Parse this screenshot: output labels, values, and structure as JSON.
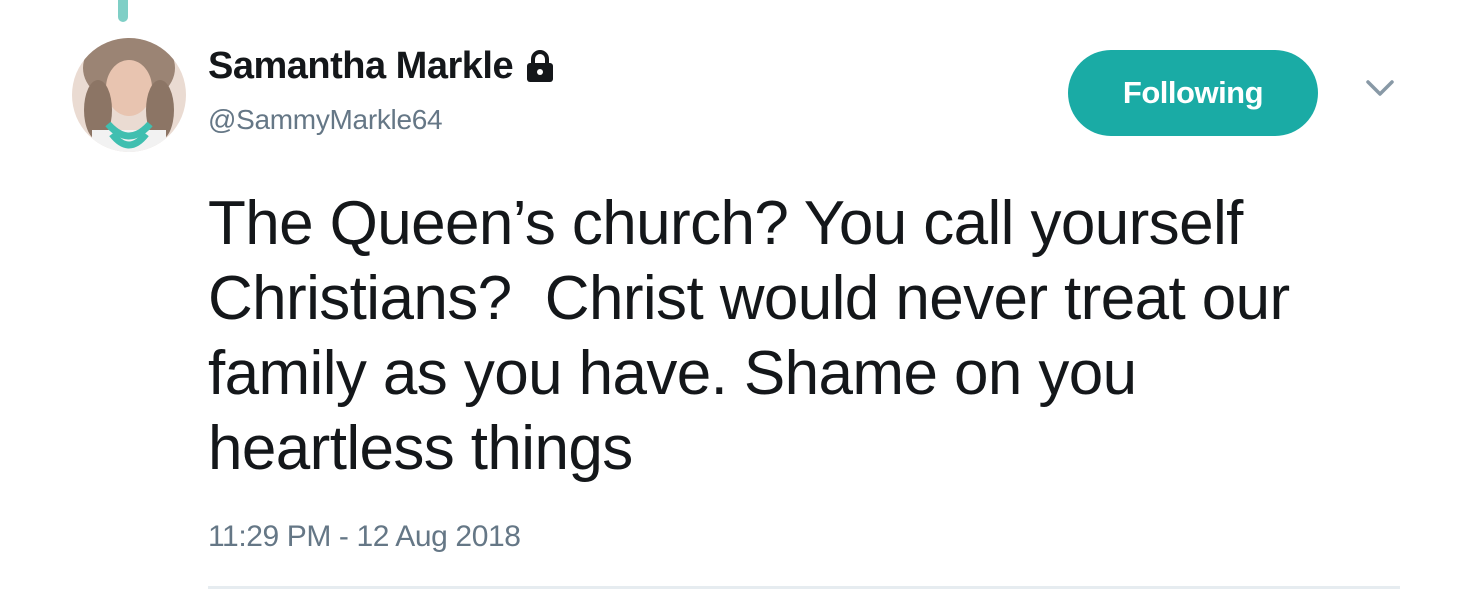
{
  "tweet": {
    "author": {
      "display_name": "Samantha Markle",
      "handle": "@SammyMarkle64",
      "avatar_icon": "profile-photo",
      "protected_icon": "lock-icon"
    },
    "follow_button_label": "Following",
    "menu_icon": "chevron-down-icon",
    "text": "The Queen’s church? You call yourself\nChristians?  Christ would never treat our\nfamily as you have. Shame on you\nheartless things",
    "timestamp": "11:29 PM - 12 Aug 2018"
  },
  "colors": {
    "accent": "#1aaba5",
    "text_primary": "#14171a",
    "text_secondary": "#657786",
    "thread_line": "#7fcfc6"
  }
}
